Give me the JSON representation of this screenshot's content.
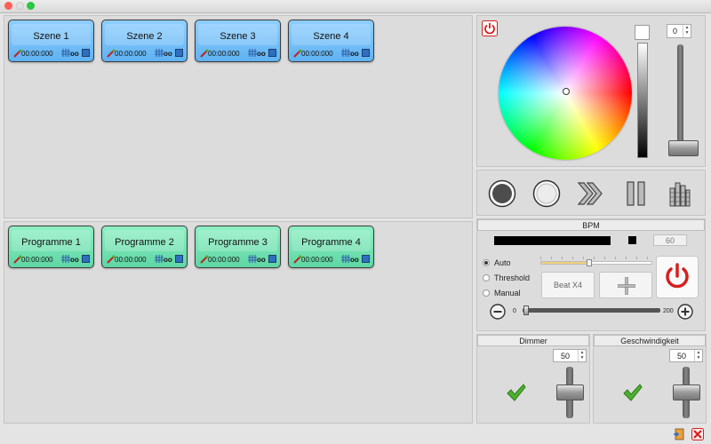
{
  "scenes": [
    {
      "title": "Szene 1",
      "time": "00:00:000",
      "loop": "oo"
    },
    {
      "title": "Szene 2",
      "time": "00:00:000",
      "loop": "oo"
    },
    {
      "title": "Szene 3",
      "time": "00:00:000",
      "loop": "oo"
    },
    {
      "title": "Szene 4",
      "time": "00:00:000",
      "loop": "oo"
    }
  ],
  "programs": [
    {
      "title": "Programme 1",
      "time": "00:00:000",
      "loop": "oo"
    },
    {
      "title": "Programme 2",
      "time": "00:00:000",
      "loop": "oo"
    },
    {
      "title": "Programme 3",
      "time": "00:00:000",
      "loop": "oo"
    },
    {
      "title": "Programme 4",
      "time": "00:00:000",
      "loop": "oo"
    }
  ],
  "color_panel": {
    "value": "0",
    "brightness_level": 0.0
  },
  "bpm": {
    "title": "BPM",
    "value": "60",
    "modes": [
      {
        "label": "Auto",
        "selected": true
      },
      {
        "label": "Threshold",
        "selected": false
      },
      {
        "label": "Manual",
        "selected": false
      }
    ],
    "beat_button": "Beat X4",
    "range_min": "0",
    "range_max": "200",
    "threshold_level": 0.43,
    "bpm_level": 0.0
  },
  "dimmer": {
    "title": "Dimmer",
    "value": "50",
    "level": 0.5
  },
  "speed": {
    "title": "Geschwindigkeit",
    "value": "50",
    "level": 0.5
  },
  "icons": {
    "power": "power-icon",
    "record": "record-icon",
    "stop": "stop-icon",
    "forward": "fast-forward-icon",
    "pause": "pause-icon",
    "equalizer": "equalizer-icon",
    "check": "check-icon",
    "export": "export-icon",
    "close": "close-icon"
  },
  "colors": {
    "power_red": "#d42020",
    "scene_blue": "#6dbbf5",
    "program_green": "#6ee0b0",
    "check_green": "#3aa028"
  }
}
